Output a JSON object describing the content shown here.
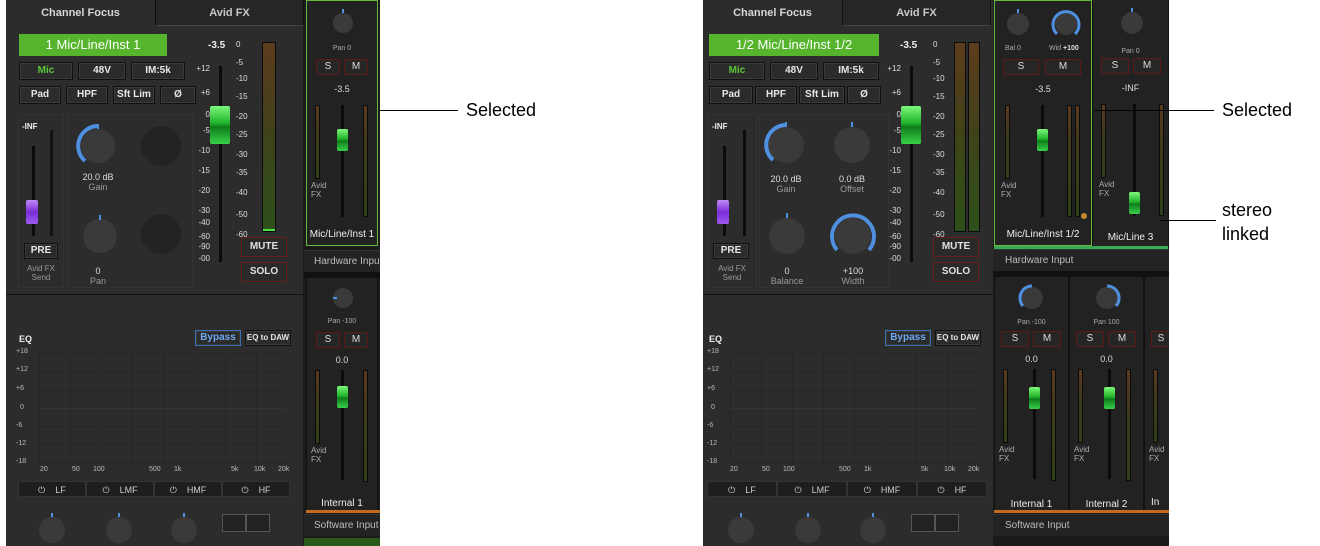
{
  "left": {
    "tabs": [
      "Channel Focus",
      "Avid FX"
    ],
    "channel_name": "1 Mic/Line/Inst 1",
    "buttons": {
      "mic": "Mic",
      "v48": "48V",
      "im": "IM:5k",
      "pad": "Pad",
      "hpf": "HPF",
      "sftlim": "Sft Lim",
      "phase": "Ø",
      "pre": "PRE",
      "mute": "MUTE",
      "solo": "SOLO",
      "bypass": "Bypass",
      "eq_to_daw": "EQ to DAW"
    },
    "fader_value": "-3.5",
    "inf": "-INF",
    "avid_send": [
      "Avid FX",
      "Send"
    ],
    "gain": {
      "value": "20.0 dB",
      "label": "Gain"
    },
    "pan": {
      "value": "0",
      "label": "Pan"
    },
    "fader_scale": [
      "+12",
      "+6",
      "0",
      "-5",
      "-10",
      "-15",
      "-20",
      "-30",
      "-40",
      "-60",
      "-90",
      "-00"
    ],
    "meter_scale": [
      "0",
      "-5",
      "-10",
      "-15",
      "-20",
      "-25",
      "-30",
      "-35",
      "-40",
      "-50",
      "-60"
    ],
    "eq_label": "EQ",
    "eq_db": [
      "+18",
      "+12",
      "+6",
      "0",
      "-6",
      "-12",
      "-18"
    ],
    "eq_freq": [
      "20",
      "50",
      "100",
      "500",
      "1k",
      "5k",
      "10k",
      "20k"
    ],
    "bands": [
      "LF",
      "LMF",
      "HMF",
      "HF"
    ],
    "strips": [
      {
        "pan": "Pan 0",
        "s": "S",
        "m": "M",
        "level": "-3.5",
        "fx": [
          "Avid",
          "FX"
        ],
        "name": "Mic/Line/Inst 1"
      },
      {
        "pan": "Pan -100",
        "s": "S",
        "m": "M",
        "level": "0.0",
        "fx": [
          "Avid",
          "FX"
        ],
        "name": "Internal 1"
      }
    ],
    "groups": [
      "Hardware Input",
      "Software Input"
    ]
  },
  "right": {
    "tabs": [
      "Channel Focus",
      "Avid FX"
    ],
    "channel_name": "1/2 Mic/Line/Inst 1/2",
    "buttons": {
      "mic": "Mic",
      "v48": "48V",
      "im": "IM:5k",
      "pad": "Pad",
      "hpf": "HPF",
      "sftlim": "Sft Lim",
      "phase": "Ø",
      "pre": "PRE",
      "mute": "MUTE",
      "solo": "SOLO",
      "bypass": "Bypass",
      "eq_to_daw": "EQ to DAW"
    },
    "fader_value": "-3.5",
    "inf": "-INF",
    "avid_send": [
      "Avid FX",
      "Send"
    ],
    "gain": {
      "value": "20.0 dB",
      "label": "Gain"
    },
    "offset": {
      "value": "0.0 dB",
      "label": "Offset"
    },
    "balance": {
      "value": "0",
      "label": "Balance"
    },
    "width": {
      "value": "+100",
      "label": "Width"
    },
    "strips_top": [
      {
        "bal": "Bal 0",
        "wid_label": "Wid",
        "wid_val": "+100",
        "s": "S",
        "m": "M",
        "level": "-3.5",
        "fx": [
          "Avid",
          "FX"
        ],
        "name": "Mic/Line/Inst 1/2"
      },
      {
        "pan": "Pan 0",
        "s": "S",
        "m": "M",
        "level": "-INF",
        "fx": [
          "Avid",
          "FX"
        ],
        "name": "Mic/Line 3"
      }
    ],
    "strips_bottom": [
      {
        "pan": "Pan -100",
        "s": "S",
        "m": "M",
        "level": "0.0",
        "fx": [
          "Avid",
          "FX"
        ],
        "name": "Internal 1"
      },
      {
        "pan": "Pan 100",
        "s": "S",
        "m": "M",
        "level": "0.0",
        "fx": [
          "Avid",
          "FX"
        ],
        "name": "Internal 2"
      },
      {
        "s": "S",
        "fx": [
          "Avid",
          "FX"
        ],
        "name": "In"
      }
    ],
    "groups": [
      "Hardware Input",
      "Software Input"
    ]
  },
  "annotations": {
    "selected_left": "Selected",
    "selected_right": "Selected",
    "stereo1": "stereo",
    "stereo2": "linked"
  },
  "colors": {
    "accent_green": "#56b52d",
    "knob_blue": "#4f8fe0",
    "fader_green": "#21b42b",
    "selection_outline": "#67b83d"
  }
}
